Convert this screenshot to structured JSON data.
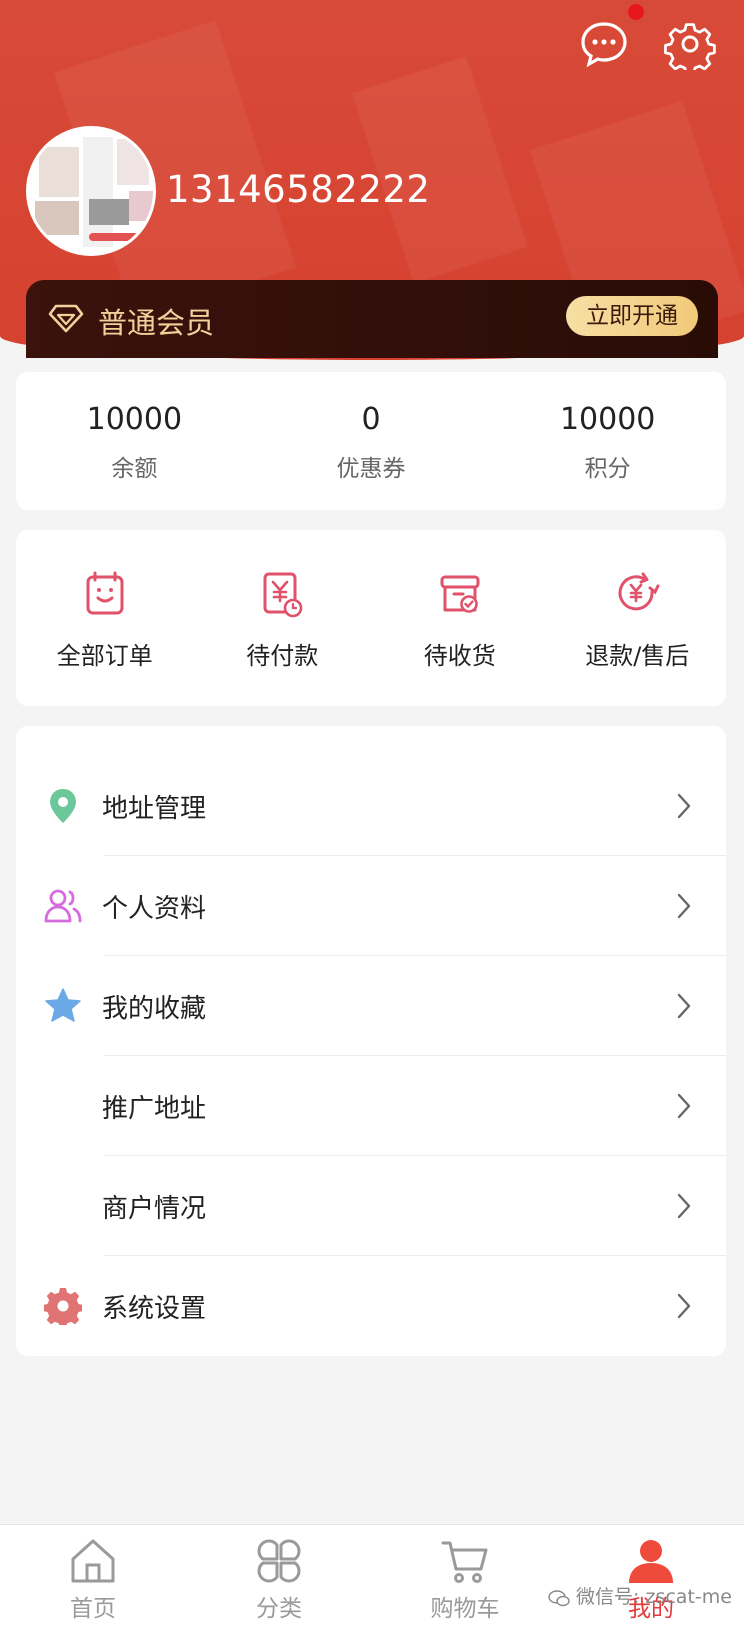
{
  "header": {
    "phone": "13146582222",
    "has_notification_dot": true
  },
  "membership": {
    "level": "普通会员",
    "action_label": "立即开通"
  },
  "stats": [
    {
      "value": "10000",
      "label": "余额"
    },
    {
      "value": "0",
      "label": "优惠券"
    },
    {
      "value": "10000",
      "label": "积分"
    }
  ],
  "orders": [
    {
      "label": "全部订单",
      "icon": "all-orders-icon"
    },
    {
      "label": "待付款",
      "icon": "pending-payment-icon"
    },
    {
      "label": "待收货",
      "icon": "pending-receipt-icon"
    },
    {
      "label": "退款/售后",
      "icon": "refund-icon"
    }
  ],
  "menu": [
    {
      "label": "地址管理",
      "icon": "location-icon"
    },
    {
      "label": "个人资料",
      "icon": "user-profile-icon"
    },
    {
      "label": "我的收藏",
      "icon": "star-icon"
    },
    {
      "label": "推广地址",
      "icon": ""
    },
    {
      "label": "商户情况",
      "icon": ""
    },
    {
      "label": "系统设置",
      "icon": "settings-gear-icon"
    }
  ],
  "tabbar": [
    {
      "label": "首页",
      "icon": "home-icon",
      "active": false
    },
    {
      "label": "分类",
      "icon": "category-icon",
      "active": false
    },
    {
      "label": "购物车",
      "icon": "cart-icon",
      "active": false
    },
    {
      "label": "我的",
      "icon": "user-icon",
      "active": true
    }
  ],
  "watermark": "微信号: zscat-me",
  "colors": {
    "primary": "#d6412f",
    "accent": "#e23a3a",
    "gold": "#f3d19a"
  }
}
